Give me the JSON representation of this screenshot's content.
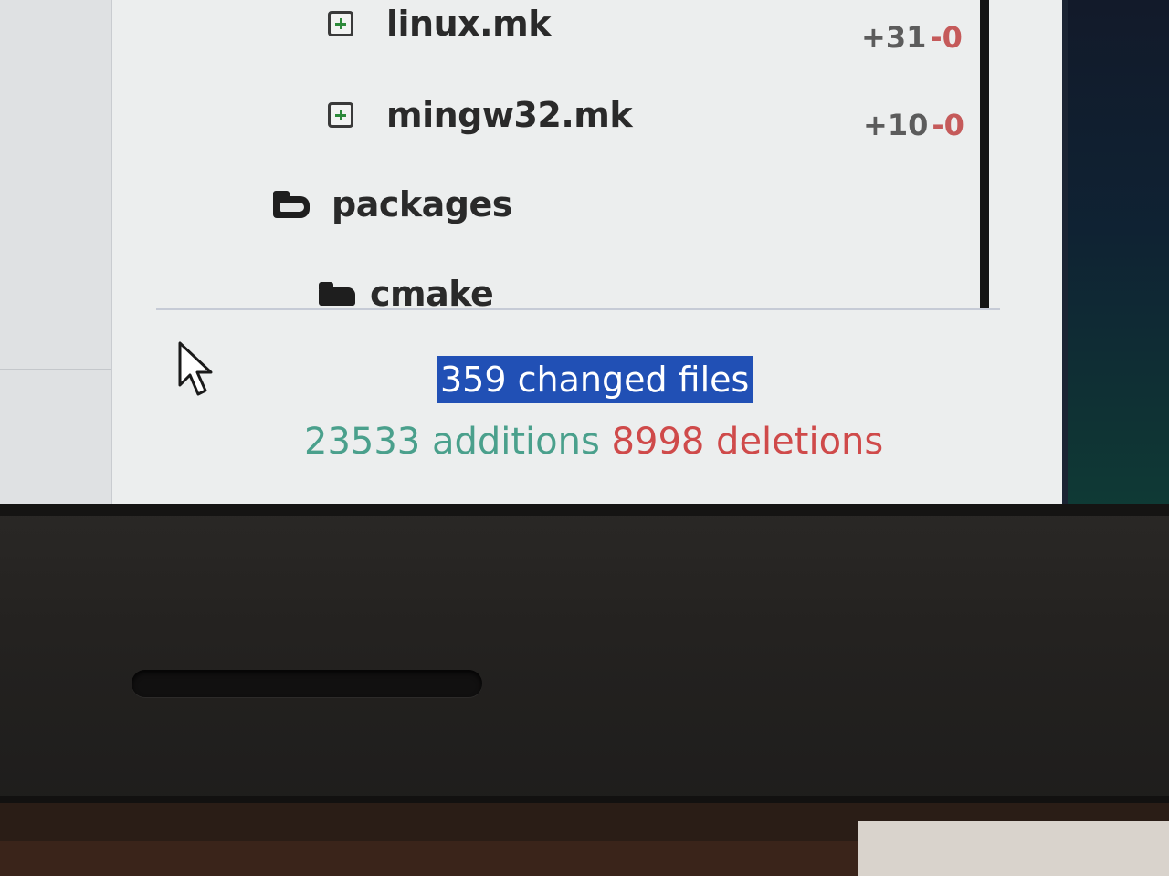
{
  "file_tree": {
    "items": [
      {
        "type": "file",
        "name": "linux.mk",
        "additions": "+31",
        "deletions": "-0"
      },
      {
        "type": "file",
        "name": "mingw32.mk",
        "additions": "+10",
        "deletions": "-0"
      },
      {
        "type": "folder",
        "name": "packages"
      },
      {
        "type": "folder",
        "name": "cmake"
      }
    ]
  },
  "summary": {
    "changed_files": "359 changed files",
    "additions": "23533 additions",
    "deletions": "8998 deletions"
  },
  "icons": {
    "file_added": "plus-square-icon",
    "folder": "folder-icon",
    "cursor": "mouse-pointer-icon"
  },
  "colors": {
    "selection": "#2150b5",
    "additions": "#4aa08c",
    "deletions": "#cf4a4a",
    "panel_bg": "#eceeee"
  }
}
